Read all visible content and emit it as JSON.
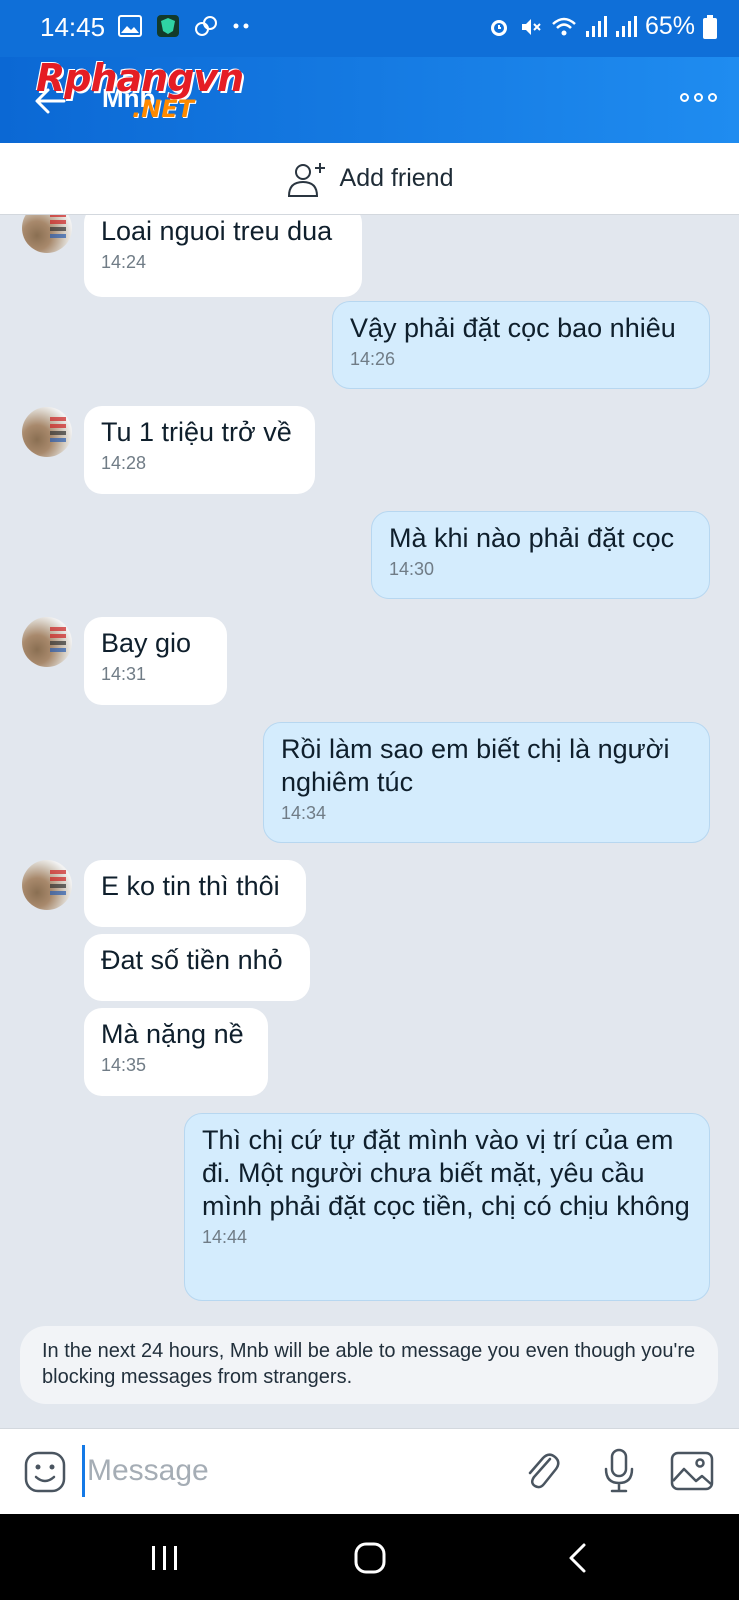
{
  "status_bar": {
    "time": "14:45",
    "battery": "65%"
  },
  "header": {
    "contact_name": "Mnb",
    "logo_top": "Rphangvn",
    "logo_bottom": ".NET"
  },
  "add_friend": {
    "label": "Add friend"
  },
  "messages": [
    {
      "dir": "in",
      "text": "Loai nguoi treu dua",
      "time": "14:24"
    },
    {
      "dir": "out",
      "text": "Vậy phải đặt cọc bao nhiêu",
      "time": "14:26"
    },
    {
      "dir": "in",
      "text": "Tu 1 triệu trở về",
      "time": "14:28"
    },
    {
      "dir": "out",
      "text": "Mà khi nào phải đặt cọc",
      "time": "14:30"
    },
    {
      "dir": "in",
      "text": "Bay gio",
      "time": "14:31"
    },
    {
      "dir": "out",
      "text": "Rồi làm sao em biết chị là người nghiêm túc",
      "time": "14:34"
    },
    {
      "dir": "in",
      "text": "E ko tin thì thôi",
      "time": ""
    },
    {
      "dir": "in",
      "text": "Đat số tiền nhỏ",
      "time": ""
    },
    {
      "dir": "in",
      "text": "Mà nặng nề",
      "time": "14:35"
    },
    {
      "dir": "out",
      "text": "Thì chị cứ tự đặt mình vào vị trí của em đi. Một người chưa biết mặt, yêu cầu mình phải đặt cọc tiền, chị có chịu không",
      "time": "14:44"
    }
  ],
  "notice": {
    "text": "In the next 24 hours, Mnb will be able to message you even though you're blocking messages from strangers."
  },
  "composer": {
    "placeholder": "Message",
    "value": ""
  },
  "icons": {
    "status_left": [
      "gallery-icon",
      "shield-app-icon",
      "link-icon",
      "more-dots-icon"
    ],
    "status_right": [
      "alarm-icon",
      "mute-icon",
      "wifi-icon",
      "signal-icon",
      "signal-icon",
      "battery-icon"
    ],
    "header": [
      "back-arrow-icon",
      "more-icon"
    ],
    "composer": [
      "emoji-icon",
      "attachment-icon",
      "microphone-icon",
      "image-icon"
    ],
    "nav": [
      "recent-apps-icon",
      "home-icon",
      "back-icon"
    ]
  },
  "colors": {
    "accent": "#0f6fd8",
    "outgoing_bubble": "#d4ecfd",
    "incoming_bubble": "#ffffff",
    "chat_background": "#e2e7ee"
  }
}
